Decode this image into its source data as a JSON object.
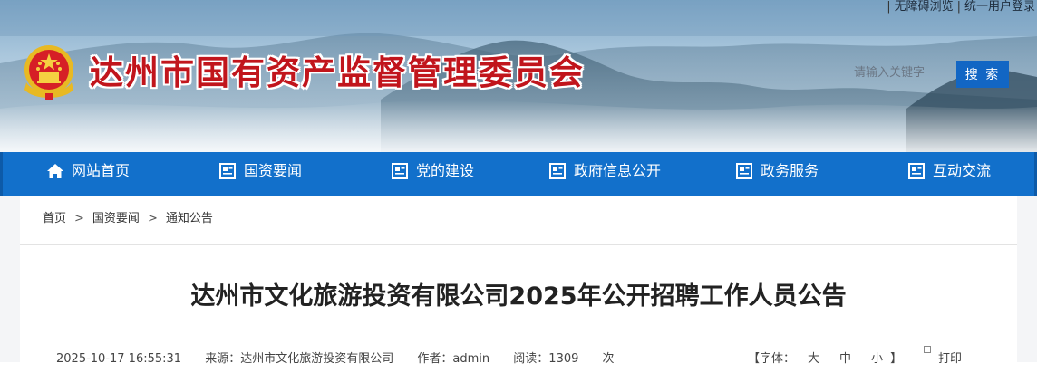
{
  "top_links": {
    "accessible": "无障碍浏览",
    "login": "统一用户登录"
  },
  "header": {
    "site_title": "达州市国有资产监督管理委员会",
    "search_placeholder": "请输入关键字",
    "search_button": "搜 索"
  },
  "nav": [
    {
      "label": "网站首页",
      "icon": "home-icon"
    },
    {
      "label": "国资要闻",
      "icon": "news-icon"
    },
    {
      "label": "党的建设",
      "icon": "document-icon"
    },
    {
      "label": "政府信息公开",
      "icon": "document-icon"
    },
    {
      "label": "政务服务",
      "icon": "document-icon"
    },
    {
      "label": "互动交流",
      "icon": "document-icon"
    }
  ],
  "breadcrumb": [
    "首页",
    "国资要闻",
    "通知公告"
  ],
  "article": {
    "title": "达州市文化旅游投资有限公司2025年公开招聘工作人员公告",
    "date": "2025-10-17 16:55:31",
    "source_label": "来源：",
    "source": "达州市文化旅游投资有限公司",
    "author_label": "作者：",
    "author": "admin",
    "views_label": "阅读：",
    "views": "1309",
    "views_unit": "次",
    "font_label": "【字体：",
    "font_large": "大",
    "font_medium": "中",
    "font_small": "小",
    "font_close": "】",
    "print": "打印"
  },
  "colors": {
    "title_red": "#c1151c",
    "nav_blue": "#1270cb",
    "button_blue": "#1266c4"
  }
}
